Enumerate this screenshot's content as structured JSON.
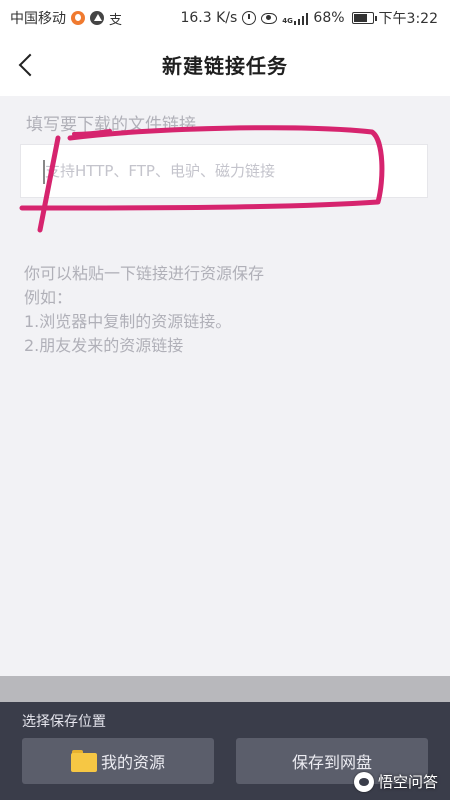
{
  "status_bar": {
    "carrier": "中国移动",
    "icon_glyph": "支",
    "net_speed": "16.3 K/s",
    "network_type": "4G",
    "battery": "68%",
    "battery_level": 0.68,
    "time": "下午3:22"
  },
  "header": {
    "title": "新建链接任务",
    "back_icon": "chevron-left-icon"
  },
  "form": {
    "label": "填写要下载的文件链接",
    "input_value": "",
    "input_placeholder": "支持HTTP、FTP、电驴、磁力链接"
  },
  "hint": {
    "lines": [
      "你可以粘贴一下链接进行资源保存",
      "例如：",
      "1.浏览器中复制的资源链接。",
      "2.朋友发来的资源链接"
    ]
  },
  "bottom_panel": {
    "label": "选择保存位置",
    "my_resources_button": "我的资源",
    "save_netdisk_button": "保存到网盘",
    "folder_icon": "folder-icon"
  },
  "watermark": {
    "text": "悟空问答"
  },
  "colors": {
    "annotation": "#d6246e",
    "panel": "#3a3d4a",
    "button": "#5b5e6b",
    "folder": "#f6c744",
    "background": "#f2f2f5"
  }
}
